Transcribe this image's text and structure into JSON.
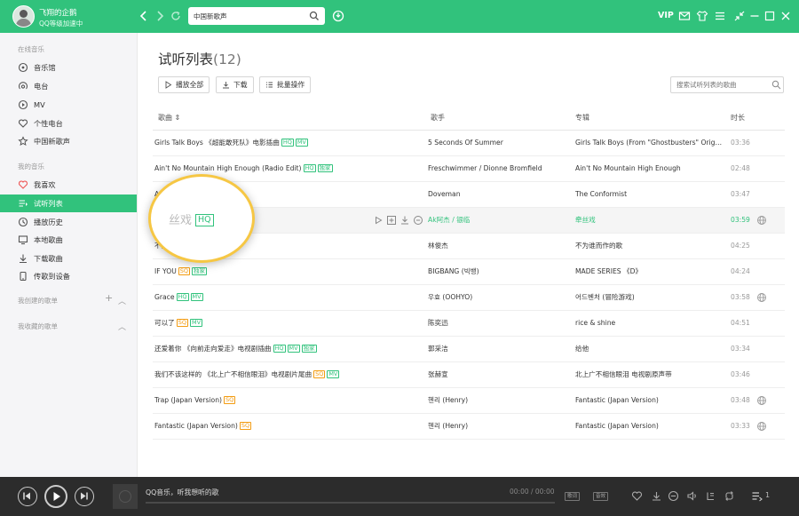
{
  "user": {
    "name": "飞翔的企鹅",
    "status": "QQ等级加速中"
  },
  "search": {
    "value": "中国新歌声"
  },
  "topbar": {
    "vip_label": "VIP",
    "accent_color": "#31c27c"
  },
  "sidebar": {
    "online_section": "在线音乐",
    "online_items": [
      {
        "label": "音乐馆",
        "icon": "music-hall-icon"
      },
      {
        "label": "电台",
        "icon": "radio-icon"
      },
      {
        "label": "MV",
        "icon": "mv-icon"
      },
      {
        "label": "个性电台",
        "icon": "heart-radio-icon"
      },
      {
        "label": "中国新歌声",
        "icon": "star-icon"
      }
    ],
    "my_section": "我的音乐",
    "my_items": [
      {
        "label": "我喜欢",
        "icon": "heart-icon"
      },
      {
        "label": "试听列表",
        "icon": "playlist-icon",
        "active": true
      },
      {
        "label": "播放历史",
        "icon": "history-icon"
      },
      {
        "label": "本地歌曲",
        "icon": "computer-icon"
      },
      {
        "label": "下载歌曲",
        "icon": "download-icon"
      },
      {
        "label": "传歌到设备",
        "icon": "device-icon"
      }
    ],
    "created_section": "我创建的歌单",
    "collected_section": "我收藏的歌单"
  },
  "main": {
    "title": "试听列表",
    "count": "(12)",
    "play_all": "播放全部",
    "download": "下载",
    "batch": "批量操作",
    "list_search_placeholder": "搜索试听列表的歌曲",
    "columns": {
      "song": "歌曲",
      "singer": "歌手",
      "album": "专辑",
      "duration": "时长"
    }
  },
  "songs": [
    {
      "title": "Girls Talk Boys 《超能敢死队》电影插曲",
      "tags": [
        "HQ",
        "MV"
      ],
      "singer": "5 Seconds Of Summer",
      "album": "Girls Talk Boys (From \"Ghostbusters\" Original...",
      "duration": "03:36",
      "globe": false
    },
    {
      "title": "Ain't No Mountain High Enough (Radio Edit)",
      "tags": [
        "HQ",
        "独家"
      ],
      "singer": "Freschwimmer / Dionne Bromfield",
      "album": "Ain't No Mountain High Enough",
      "duration": "02:48",
      "globe": false
    },
    {
      "title": "Ange",
      "tags": [],
      "singer": "Doveman",
      "album": "The Conformist",
      "duration": "03:47",
      "globe": false
    },
    {
      "title": "牵",
      "tags": [],
      "singer": "Ak阿杰 / 银临",
      "album": "牵丝戏",
      "duration": "03:59",
      "globe": true,
      "highlight": true
    },
    {
      "title": "不为",
      "tags": [
        "MV"
      ],
      "singer": "林俊杰",
      "album": "不为谁而作的歌",
      "duration": "04:25",
      "globe": false
    },
    {
      "title": "IF YOU",
      "tags": [
        "SQ",
        "独家"
      ],
      "singer": "BIGBANG (빅뱅)",
      "album": "MADE SERIES 《D》",
      "duration": "04:24",
      "globe": false
    },
    {
      "title": "Grace",
      "tags": [
        "HQ",
        "MV"
      ],
      "singer": "우효 (OOHYO)",
      "album": "어드벤처 (冒险游戏)",
      "duration": "03:58",
      "globe": true
    },
    {
      "title": "可以了",
      "tags": [
        "SQ",
        "MV"
      ],
      "singer": "陈奕迅",
      "album": "rice & shine",
      "duration": "04:51",
      "globe": false
    },
    {
      "title": "还爱着你 《向前走向爱走》电视剧插曲",
      "tags": [
        "HQ",
        "MV",
        "独家"
      ],
      "singer": "郭采洁",
      "album": "给他",
      "duration": "03:34",
      "globe": false
    },
    {
      "title": "我们不该这样的 《北上广不相信眼泪》电视剧片尾曲",
      "tags": [
        "SQ",
        "MV"
      ],
      "singer": "张赫宣",
      "album": "北上广不相信眼泪 电视剧原声带",
      "duration": "03:46",
      "globe": false
    },
    {
      "title": "Trap (Japan Version)",
      "tags": [
        "SQ"
      ],
      "singer": "헨리 (Henry)",
      "album": "Fantastic (Japan Version)",
      "duration": "03:48",
      "globe": true
    },
    {
      "title": "Fantastic (Japan Version)",
      "tags": [
        "SQ"
      ],
      "singer": "헨리 (Henry)",
      "album": "Fantastic (Japan Version)",
      "duration": "03:33",
      "globe": true
    }
  ],
  "magnifier": {
    "text": "丝戏",
    "tag": "HQ"
  },
  "player": {
    "title": "QQ音乐，听我想听的歌",
    "time": "00:00 / 00:00",
    "queue_count": "1",
    "lyric_label": "歌词",
    "effect_label": "音效"
  }
}
